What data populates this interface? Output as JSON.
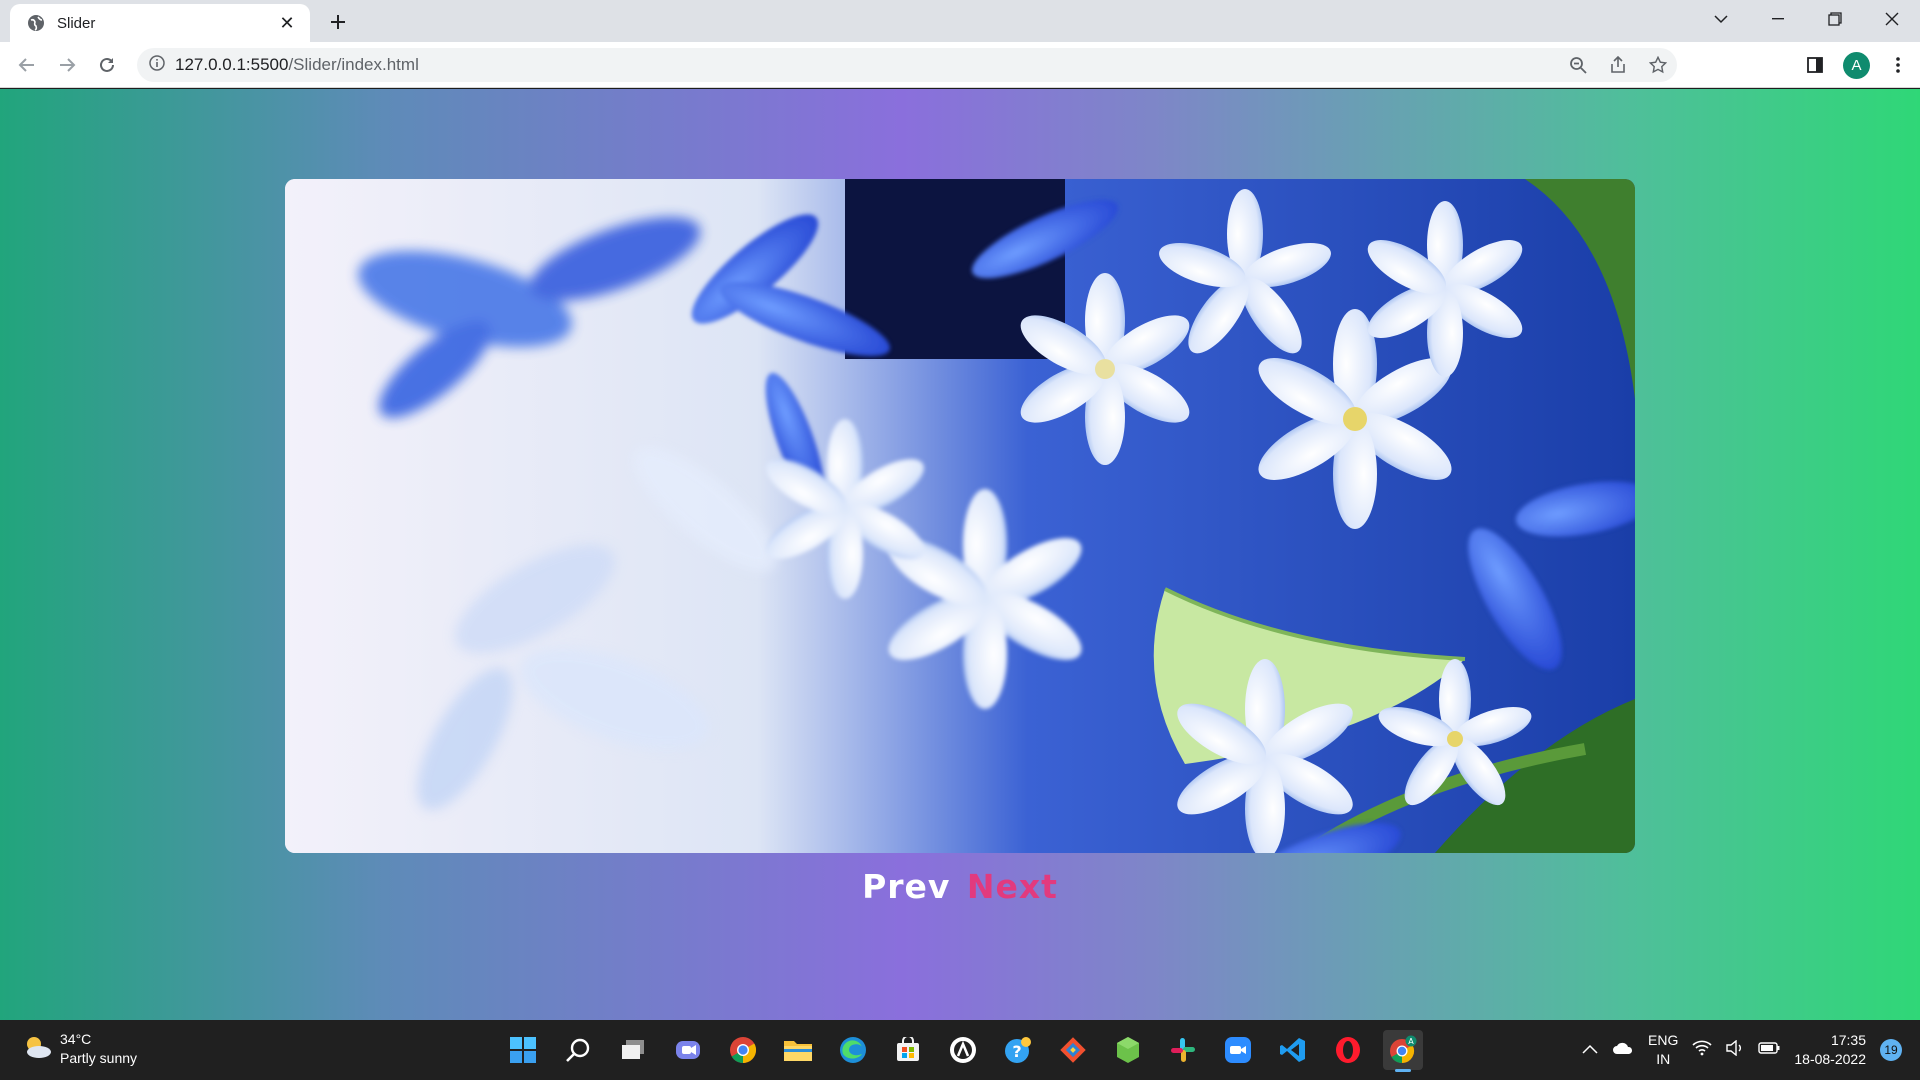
{
  "browser": {
    "tab_title": "Slider",
    "url_host": "127.0.0.1:5500",
    "url_path": "/Slider/index.html",
    "profile_initial": "A"
  },
  "slider": {
    "prev_label": "Prev",
    "next_label": "Next",
    "image_icon": "flower-photo"
  },
  "taskbar": {
    "weather_temp": "34°C",
    "weather_desc": "Partly sunny",
    "lang_top": "ENG",
    "lang_bottom": "IN",
    "time": "17:35",
    "date": "18-08-2022",
    "notifications": "19",
    "apps": [
      "start-icon",
      "search-icon",
      "task-view-icon",
      "teams-icon",
      "chrome-icon",
      "file-explorer-icon",
      "edge-icon",
      "store-icon",
      "app-icon",
      "help-icon",
      "git-icon",
      "node-icon",
      "slack-icon",
      "zoom-icon",
      "vscode-icon",
      "opera-icon",
      "chrome-profile-icon"
    ]
  },
  "colors": {
    "next_accent": "#e23a7e",
    "gradient_center": "#8a6fdc",
    "gradient_edge": "#2fd777"
  }
}
